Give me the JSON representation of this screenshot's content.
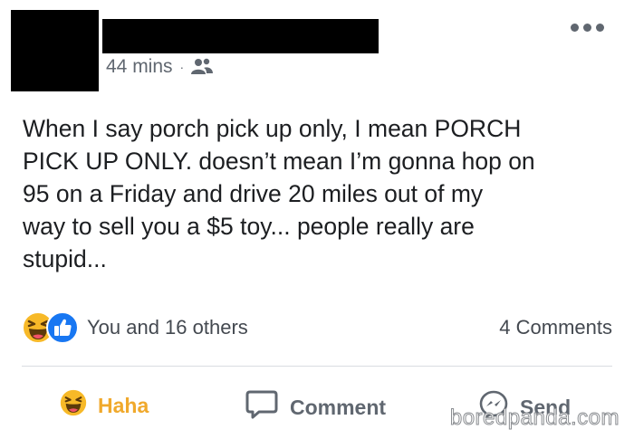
{
  "post": {
    "author_avatar": "redacted",
    "author_name": "redacted",
    "timestamp": "44 mins",
    "separator": "·",
    "audience_icon": "friends-icon",
    "more_icon": "more-options-icon",
    "text": "When I say porch pick up only, I mean PORCH\nPICK UP ONLY.  doesn’t mean I’m gonna hop on\n95 on a Friday and drive 20 miles out of my\nway to sell you a $5 toy... people really are\nstupid..."
  },
  "reactions": {
    "icons": [
      "haha-icon",
      "like-icon"
    ],
    "summary": "You and 16 others",
    "comments_count": "4 Comments"
  },
  "actions": {
    "haha_label": "Haha",
    "comment_label": "Comment",
    "send_label": "Send"
  },
  "watermark": {
    "text": "boredpanda.com"
  },
  "colors": {
    "haha_accent": "#f0a92c",
    "like_blue": "#1877f2",
    "muted_text": "#606770",
    "divider": "#dadde1"
  }
}
